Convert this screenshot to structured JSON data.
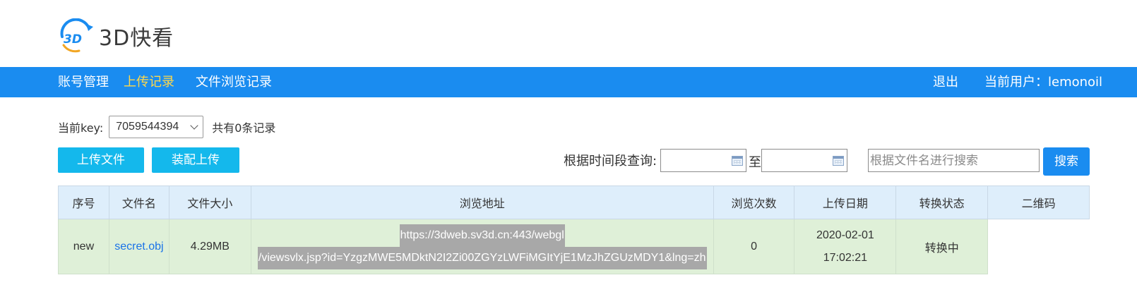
{
  "brand": {
    "mark_text": "3D",
    "title": "3D快看"
  },
  "nav": {
    "left": [
      {
        "label": "账号管理",
        "active": false
      },
      {
        "label": "上传记录",
        "active": true
      },
      {
        "label": "文件浏览记录",
        "active": false
      }
    ],
    "logout_label": "退出",
    "current_user_label": "当前用户：lemonoil"
  },
  "key": {
    "label": "当前key:",
    "selected_value": "7059544394",
    "record_count_text": "共有0条记录"
  },
  "toolbar": {
    "upload_file_label": "上传文件",
    "assembly_upload_label": "装配上传",
    "time_query_label": "根据时间段查询:",
    "to_label": "至",
    "start_date_value": "",
    "end_date_value": "",
    "search_placeholder": "根据文件名进行搜索",
    "search_button_label": "搜索"
  },
  "table": {
    "headers": [
      "序号",
      "文件名",
      "文件大小",
      "浏览地址",
      "浏览次数",
      "上传日期",
      "转换状态",
      "二维码"
    ],
    "rows": [
      {
        "index": "new",
        "filename": "secret.obj",
        "filesize": "4.29MB",
        "url_line1": "https://3dweb.sv3d.cn:443/webgl",
        "url_line2": "/viewsvlx.jsp?id=YzgzMWE5MDktN2I2Zi00ZGYzLWFiMGItYjE1MzJhZGUzMDY1&lng=zh",
        "views": "0",
        "upload_date": "2020-02-01",
        "upload_time": "17:02:21",
        "status": "转换中",
        "qrcode": ""
      }
    ]
  },
  "colors": {
    "nav_bg": "#1a8cf0",
    "nav_active": "#ffd84a",
    "button_cyan": "#14b8ec",
    "button_blue": "#1a8cf0",
    "header_row_bg": "#deeefb",
    "data_row_bg": "#dff0d8",
    "link": "#1a73e8"
  }
}
